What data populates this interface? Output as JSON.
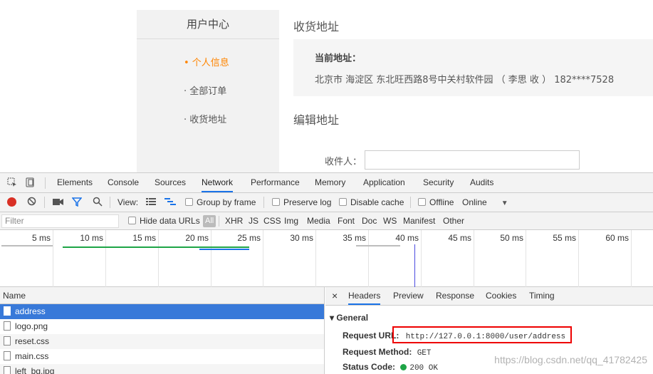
{
  "page": {
    "sidebar": {
      "title": "用户中心",
      "items": [
        {
          "label": "• 个人信息"
        },
        {
          "label": "· 全部订单"
        },
        {
          "label": "· 收货地址"
        }
      ]
    },
    "main": {
      "section1_title": "收货地址",
      "current_label": "当前地址：",
      "current_address": "北京市 海淀区 东北旺西路8号中关村软件园 （ 李思 收 ） 182****7528",
      "section2_title": "编辑地址",
      "recipient_label": "收件人："
    }
  },
  "devtools": {
    "tabs": [
      "Elements",
      "Console",
      "Sources",
      "Network",
      "Performance",
      "Memory",
      "Application",
      "Security",
      "Audits"
    ],
    "active_tab": "Network",
    "toolbar": {
      "view_label": "View:",
      "group_by_frame": "Group by frame",
      "preserve_log": "Preserve log",
      "disable_cache": "Disable cache",
      "offline": "Offline",
      "throttle": "Online"
    },
    "filter": {
      "placeholder": "Filter",
      "hide_data_urls": "Hide data URLs",
      "types": [
        "All",
        "XHR",
        "JS",
        "CSS",
        "Img",
        "Media",
        "Font",
        "Doc",
        "WS",
        "Manifest",
        "Other"
      ]
    },
    "timeline_ticks": [
      "5 ms",
      "10 ms",
      "15 ms",
      "20 ms",
      "25 ms",
      "30 ms",
      "35 ms",
      "40 ms",
      "45 ms",
      "50 ms",
      "55 ms",
      "60 ms"
    ],
    "requests": {
      "column": "Name",
      "rows": [
        "address",
        "logo.png",
        "reset.css",
        "main.css",
        "left_bg.jpg"
      ]
    },
    "details": {
      "close": "×",
      "tabs": [
        "Headers",
        "Preview",
        "Response",
        "Cookies",
        "Timing"
      ],
      "general_title": "▾ General",
      "request_url_label": "Request URL:",
      "request_url": "http://127.0.0.1:8000/user/address",
      "request_method_label": "Request Method:",
      "request_method": "GET",
      "status_code_label": "Status Code:",
      "status_code": "200 OK"
    },
    "watermark": "https://blog.csdn.net/qq_41782425"
  }
}
